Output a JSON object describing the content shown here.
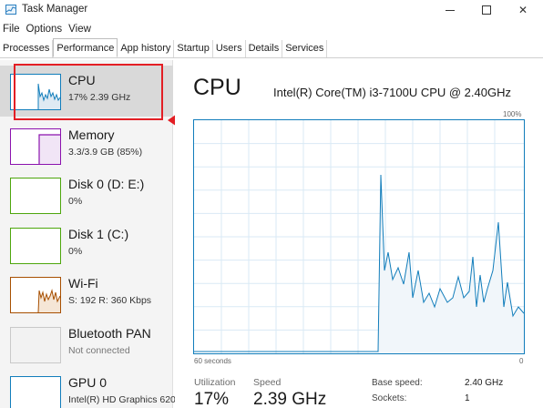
{
  "window": {
    "title": "Task Manager"
  },
  "menu": [
    "File",
    "Options",
    "View"
  ],
  "tabs": [
    "Processes",
    "Performance",
    "App history",
    "Startup",
    "Users",
    "Details",
    "Services"
  ],
  "active_tab": "Performance",
  "sidebar": {
    "items": [
      {
        "name": "CPU",
        "sub": "17%  2.39 GHz",
        "selected": true,
        "color": "#117dbb"
      },
      {
        "name": "Memory",
        "sub": "3.3/3.9 GB (85%)",
        "color": "#8b12ae"
      },
      {
        "name": "Disk 0 (D: E:)",
        "sub": "0%",
        "color": "#4da60c"
      },
      {
        "name": "Disk 1 (C:)",
        "sub": "0%",
        "color": "#4da60c"
      },
      {
        "name": "Wi-Fi",
        "sub": "S: 192  R: 360 Kbps",
        "color": "#a74f01"
      },
      {
        "name": "Bluetooth PAN",
        "sub": "Not connected",
        "color": "#a74f01"
      },
      {
        "name": "GPU 0",
        "sub": "Intel(R) HD Graphics 620",
        "color": "#117dbb"
      }
    ]
  },
  "main": {
    "title": "CPU",
    "model": "Intel(R) Core(TM) i3-7100U CPU @ 2.40GHz",
    "graph_top_right": "100%",
    "graph_bottom_left": "60 seconds",
    "graph_bottom_right": "0",
    "stats": {
      "utilization_label": "Utilization",
      "utilization_value": "17%",
      "speed_label": "Speed",
      "speed_value": "2.39 GHz"
    },
    "specs": {
      "base_speed_label": "Base speed:",
      "base_speed_value": "2.40 GHz",
      "sockets_label": "Sockets:",
      "sockets_value": "1"
    }
  },
  "colors": {
    "cpu_line": "#117dbb",
    "cpu_fill": "#f1f6fa",
    "highlight": "#e31e24"
  }
}
